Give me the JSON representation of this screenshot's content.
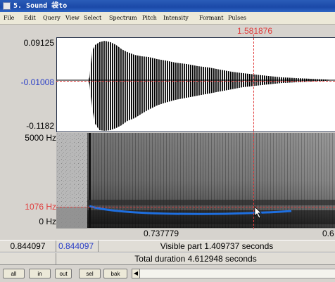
{
  "window": {
    "title": "5. Sound 袋to"
  },
  "menu": [
    "File",
    "Edit",
    "Query",
    "View",
    "Select",
    "Spectrum",
    "Pitch",
    "Intensity",
    "Formant",
    "Pulses"
  ],
  "cursor": {
    "time_label": "1.581876"
  },
  "waveform": {
    "y_top": "0.09125",
    "y_cursor": "-0.01008",
    "y_bottom": "-0.1182"
  },
  "spectrogram": {
    "y_top": "5000 Hz",
    "y_cursor": "1076 Hz",
    "y_bottom": "0 Hz"
  },
  "time_axis": {
    "left_window_label": "0.737779",
    "right_partial_label": "0.6"
  },
  "status": {
    "start_time": "0.844097",
    "start_time_blue": "0.844097",
    "visible_part": "Visible part 1.409737 seconds",
    "total_duration": "Total duration 4.612948 seconds"
  },
  "buttons": [
    "all",
    "in",
    "out",
    "sel",
    "bak"
  ],
  "colors": {
    "cursor": "#e03c3c",
    "pitch": "#1e6fe0",
    "axis_blue": "#2b3fc7",
    "titlebar": "#1b49a8"
  }
}
